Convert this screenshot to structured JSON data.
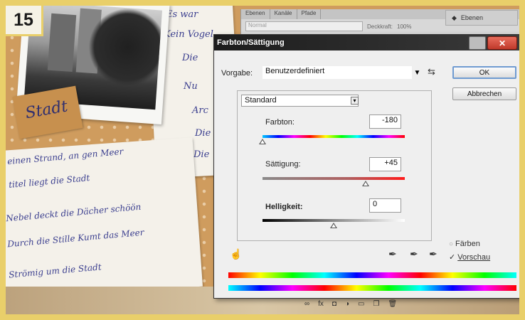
{
  "step_badge": "15",
  "layers_panel": {
    "tabs": [
      "Ebenen",
      "Kanäle",
      "Pfade"
    ],
    "blend_mode": "Normal",
    "opacity_label": "Deckkraft:",
    "opacity_value": "100%",
    "right_button": "Ebenen"
  },
  "dialog": {
    "title": "Farbton/Sättigung",
    "preset_label": "Vorgabe:",
    "preset_value": "Benutzerdefiniert",
    "channel_value": "Standard",
    "ok_label": "OK",
    "cancel_label": "Abbrechen",
    "hue": {
      "label": "Farbton:",
      "value": "-180",
      "level": 0.0
    },
    "saturation": {
      "label": "Sättigung:",
      "value": "+45",
      "level": 0.725
    },
    "lightness": {
      "label": "Helligkeit:",
      "value": "0",
      "level": 0.5
    },
    "colorize_label": "Färben",
    "colorize_checked": false,
    "preview_label": "Vorschau",
    "preview_checked": true
  },
  "handwriting": {
    "tag": "Stadt",
    "right_lines": [
      "Es war",
      "Kein Vogel",
      "Die",
      "Nu",
      "Arc",
      "Die",
      "Die"
    ],
    "left_lines": [
      "einen Strand, an gen Meer",
      "titel liegt die Stadt",
      "Nebel deckt die Dächer schöön",
      "Durch die Stille Kumt das Meer",
      "Strömig um die Stadt"
    ]
  },
  "colors": {
    "frame": "#e9cf6a",
    "dialog_title_bg": "#2a2a2a",
    "close_button": "#c0392b",
    "kraft_paper": "#cf9c5e"
  }
}
